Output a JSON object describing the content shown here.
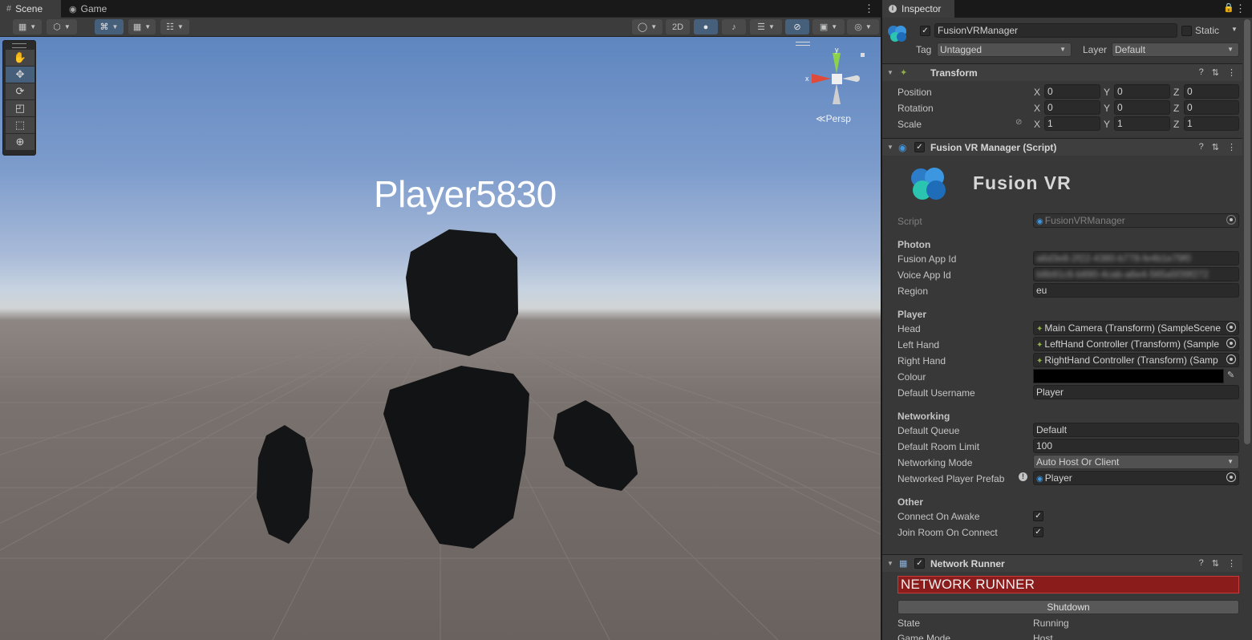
{
  "scene_tabs": [
    {
      "label": "Scene",
      "icon": "grid-icon"
    },
    {
      "label": "Game",
      "icon": "gamepad-icon"
    }
  ],
  "toolbar": {
    "mode_2d": "2D"
  },
  "tools": [
    "hand-icon",
    "move-icon",
    "rotate-icon",
    "scale-icon",
    "rect-icon",
    "transform-icon"
  ],
  "viewport": {
    "player_label": "Player5830",
    "gizmo_x": "x",
    "gizmo_y": "y",
    "projection": "Persp"
  },
  "inspector": {
    "tab_label": "Inspector",
    "object_name": "FusionVRManager",
    "static_label": "Static",
    "tag_label": "Tag",
    "tag_value": "Untagged",
    "layer_label": "Layer",
    "layer_value": "Default",
    "transform": {
      "title": "Transform",
      "rows": [
        {
          "label": "Position",
          "x": "0",
          "y": "0",
          "z": "0"
        },
        {
          "label": "Rotation",
          "x": "0",
          "y": "0",
          "z": "0"
        },
        {
          "label": "Scale",
          "x": "1",
          "y": "1",
          "z": "1"
        }
      ],
      "axis_x": "X",
      "axis_y": "Y",
      "axis_z": "Z"
    },
    "fusion_script": {
      "title": "Fusion VR Manager (Script)",
      "logo_text": "Fusion VR",
      "script_label": "Script",
      "script_value": "FusionVRManager",
      "photon_header": "Photon",
      "fusion_app_id_label": "Fusion App Id",
      "fusion_app_id_value": "a6d3e8-2f22-4380-b778-fe4b1e79f0",
      "voice_app_id_label": "Voice App Id",
      "voice_app_id_value": "b8b91c6-b890-4cab-a6e4-565a5f39f272",
      "region_label": "Region",
      "region_value": "eu",
      "player_header": "Player",
      "head_label": "Head",
      "head_value": "Main Camera (Transform) (SampleScene",
      "left_hand_label": "Left Hand",
      "left_hand_value": "LeftHand Controller (Transform) (Sample",
      "right_hand_label": "Right Hand",
      "right_hand_value": "RightHand Controller (Transform) (Samp",
      "colour_label": "Colour",
      "colour_value": "#000000",
      "default_username_label": "Default Username",
      "default_username_value": "Player",
      "networking_header": "Networking",
      "default_queue_label": "Default Queue",
      "default_queue_value": "Default",
      "default_room_limit_label": "Default Room Limit",
      "default_room_limit_value": "100",
      "networking_mode_label": "Networking Mode",
      "networking_mode_value": "Auto Host Or Client",
      "networked_player_prefab_label": "Networked Player Prefab",
      "networked_player_prefab_value": "Player",
      "other_header": "Other",
      "connect_on_awake_label": "Connect On Awake",
      "join_room_label": "Join Room On Connect"
    },
    "network_runner": {
      "title": "Network Runner",
      "banner": "NETWORK RUNNER",
      "shutdown_label": "Shutdown",
      "state_label": "State",
      "state_value": "Running",
      "game_mode_label": "Game Mode",
      "game_mode_value": "Host"
    }
  },
  "colors": {
    "accent": "#46607c",
    "banner_red": "#8a1c1c"
  }
}
